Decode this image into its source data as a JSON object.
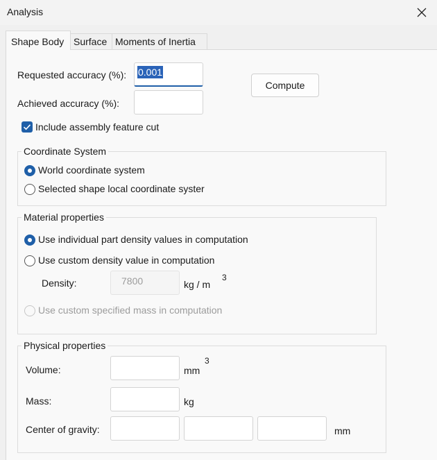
{
  "window": {
    "title": "Analysis"
  },
  "tabs": [
    "Shape Body",
    "Surface",
    "Moments of Inertia"
  ],
  "accuracy": {
    "requested_label": "Requested accuracy (%):",
    "requested_value": "0.001",
    "achieved_label": "Achieved accuracy (%):",
    "achieved_value": "",
    "compute_label": "Compute",
    "include_cut_label": "Include assembly feature cut",
    "include_cut_checked": true
  },
  "coordinate_system": {
    "title": "Coordinate System",
    "options": [
      "World coordinate system",
      "Selected shape local coordinate syster"
    ],
    "selected_index": 0
  },
  "material": {
    "title": "Material properties",
    "option_individual": "Use individual part density values in computation",
    "option_custom_density": "Use custom density value in computation",
    "density_label": "Density:",
    "density_value": "7800",
    "density_unit": "kg / m",
    "density_unit_exp": "3",
    "option_custom_mass": "Use custom specified mass in computation",
    "selected_index": 0
  },
  "physical": {
    "title": "Physical  properties",
    "volume_label": "Volume:",
    "volume_unit": "mm",
    "volume_unit_exp": "3",
    "mass_label": "Mass:",
    "mass_unit": "kg",
    "cog_label": "Center of gravity:",
    "cog_unit": "mm"
  },
  "icons": {
    "close": "close-icon",
    "check": "checkmark-icon"
  },
  "colors": {
    "accent": "#1f5fa8",
    "selection": "#2a63b8",
    "disabled_text": "#9c9c9c"
  }
}
